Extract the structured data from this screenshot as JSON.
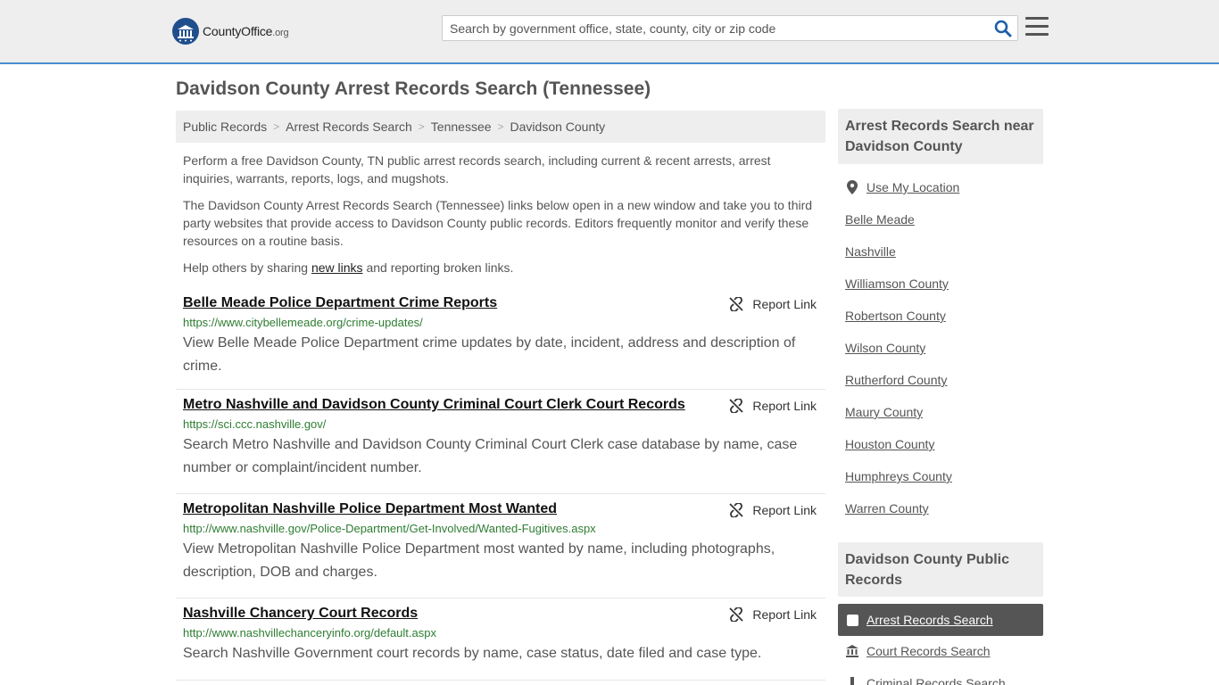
{
  "header": {
    "logo_brand": "CountyOffice",
    "logo_tld": ".org",
    "search_placeholder": "Search by government office, state, county, city or zip code"
  },
  "page": {
    "title": "Davidson County Arrest Records Search (Tennessee)"
  },
  "breadcrumb": [
    "Public Records",
    "Arrest Records Search",
    "Tennessee",
    "Davidson County"
  ],
  "intro": {
    "p1": "Perform a free Davidson County, TN public arrest records search, including current & recent arrests, arrest inquiries, warrants, reports, logs, and mugshots.",
    "p2": "The Davidson County Arrest Records Search (Tennessee) links below open in a new window and take you to third party websites that provide access to Davidson County public records. Editors frequently monitor and verify these resources on a routine basis.",
    "p3_before": "Help others by sharing ",
    "p3_link": "new links",
    "p3_after": " and reporting broken links."
  },
  "report_label": "Report Link",
  "records": [
    {
      "title": "Belle Meade Police Department Crime Reports",
      "url": "https://www.citybellemeade.org/crime-updates/",
      "desc": "View Belle Meade Police Department crime updates by date, incident, address and description of crime."
    },
    {
      "title": "Metro Nashville and Davidson County Criminal Court Clerk Court Records",
      "url": "https://sci.ccc.nashville.gov/",
      "desc": "Search Metro Nashville and Davidson County Criminal Court Clerk case database by name, case number or complaint/incident number."
    },
    {
      "title": "Metropolitan Nashville Police Department Most Wanted",
      "url": "http://www.nashville.gov/Police-Department/Get-Involved/Wanted-Fugitives.aspx",
      "desc": "View Metropolitan Nashville Police Department most wanted by name, including photographs, description, DOB and charges."
    },
    {
      "title": "Nashville Chancery Court Records",
      "url": "http://www.nashvillechanceryinfo.org/default.aspx",
      "desc": "Search Nashville Government court records by name, case status, date filed and case type."
    }
  ],
  "sidebar": {
    "near_title": "Arrest Records Search near Davidson County",
    "use_location": "Use My Location",
    "near_links": [
      "Belle Meade",
      "Nashville",
      "Williamson County",
      "Robertson County",
      "Wilson County",
      "Rutherford County",
      "Maury County",
      "Houston County",
      "Humphreys County",
      "Warren County"
    ],
    "public_title": "Davidson County Public Records",
    "public_links": [
      "Arrest Records Search",
      "Court Records Search",
      "Criminal Records Search"
    ]
  },
  "colors": {
    "header_bg": "#eeeeee",
    "accent_border": "#4a8fd0",
    "search_icon": "#1f5fa8",
    "url_green": "#2e7d32",
    "active_bg": "#555555"
  },
  "icons": {
    "logo": "county-seal-icon",
    "search": "search-icon",
    "menu": "hamburger-menu-icon",
    "report": "broken-link-icon",
    "location": "map-marker-icon",
    "court": "courthouse-icon",
    "criminal": "handcuff-icon"
  }
}
